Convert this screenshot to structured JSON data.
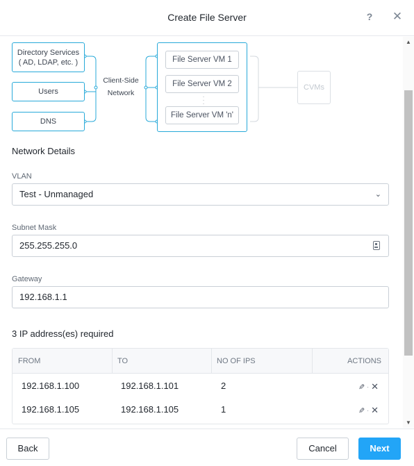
{
  "dialog": {
    "title": "Create File Server",
    "help_label": "?",
    "close_label": "✕"
  },
  "diagram": {
    "directory_services": "Directory Services\n( AD, LDAP, etc. )",
    "users": "Users",
    "dns": "DNS",
    "network_label_line1": "Client-Side",
    "network_label_line2": "Network",
    "vm1": "File Server VM 1",
    "vm2": "File Server VM 2",
    "vmn": "File Server VM 'n'",
    "cvms": "CVMs",
    "accent_color": "#27a9d9"
  },
  "network_details": {
    "title": "Network Details",
    "vlan_label": "VLAN",
    "vlan_value": "Test - Unmanaged",
    "subnet_label": "Subnet Mask",
    "subnet_value": "255.255.255.0",
    "gateway_label": "Gateway",
    "gateway_value": "192.168.1.1"
  },
  "ip_table": {
    "title": "3 IP address(es) required",
    "headers": [
      "FROM",
      "TO",
      "NO OF IPS",
      "ACTIONS"
    ],
    "rows": [
      {
        "from": "192.168.1.100",
        "to": "192.168.1.101",
        "count": "2"
      },
      {
        "from": "192.168.1.105",
        "to": "192.168.1.105",
        "count": "1"
      }
    ]
  },
  "footer": {
    "back": "Back",
    "cancel": "Cancel",
    "next": "Next",
    "primary_color": "#22a5f7"
  }
}
